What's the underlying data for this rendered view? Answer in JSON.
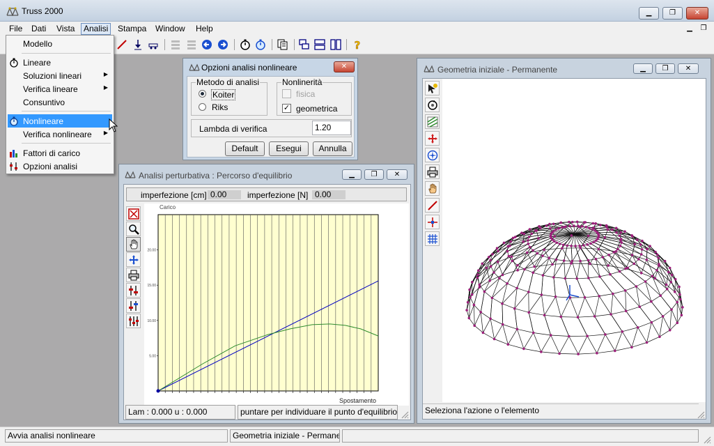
{
  "app": {
    "title": "Truss 2000"
  },
  "menubar": {
    "items": [
      "File",
      "Dati",
      "Vista",
      "Analisi",
      "Stampa",
      "Window",
      "Help"
    ]
  },
  "analisi_menu": {
    "items": [
      {
        "label": "Modello"
      },
      {
        "label": "Lineare"
      },
      {
        "label": "Soluzioni lineari"
      },
      {
        "label": "Verifica lineare"
      },
      {
        "label": "Consuntivo"
      },
      {
        "label": "Nonlineare"
      },
      {
        "label": "Verifica nonlineare"
      },
      {
        "label": "Fattori di carico"
      },
      {
        "label": "Opzioni analisi"
      }
    ]
  },
  "dialog": {
    "title": "Opzioni analisi nonlineare",
    "metodo_title": "Metodo di analisi",
    "metodo_options": [
      "Koiter",
      "Riks"
    ],
    "metodo_selected": "Koiter",
    "nonlin_title": "Nonlinerità",
    "nonlin_options": [
      {
        "label": "fisica",
        "checked": false,
        "enabled": false
      },
      {
        "label": "geometrica",
        "checked": true,
        "enabled": true
      }
    ],
    "lambda_label": "Lambda di verifica",
    "lambda_value": "1.20",
    "buttons": [
      "Default",
      "Esegui",
      "Annulla"
    ]
  },
  "perturb_window": {
    "title": "Analisi perturbativa : Percorso d'equilibrio",
    "imperf_cm_label": "imperfezione [cm]",
    "imperf_cm_value": "0.00",
    "imperf_n_label": "imperfezione [N]",
    "imperf_n_value": "0.00",
    "status_left": "Lam : 0.000  u : 0.000",
    "status_right": "puntare per individuare il punto d'equilibrio"
  },
  "geom_window": {
    "title": "Geometria iniziale - Permanente",
    "status": "Seleziona l'azione o l'elemento"
  },
  "statusbar": {
    "left": "Avvia analisi nonlineare",
    "middle": "Geometria iniziale - Permaner"
  },
  "colors": {
    "menu_highlight": "#3399ff",
    "plot_background": "#ffffd0",
    "linear_path": "#0000c0",
    "nonlinear_path": "#2e8b2e",
    "dome_members": "#000000",
    "dome_nodes": "#9b1f7a"
  },
  "chart_data": {
    "type": "line",
    "ylabel": "Carico",
    "xlabel": "Spostamento",
    "xlim": [
      0,
      1
    ],
    "ylim": [
      0,
      25
    ],
    "yticks": [
      "5.00",
      "10.00",
      "15.00",
      "20.00"
    ],
    "series": [
      {
        "color": "#0000c0",
        "x": [
          0,
          1
        ],
        "y": [
          0,
          15.6
        ]
      },
      {
        "color": "#2e8b2e",
        "x": [
          0,
          0.2,
          0.35,
          0.5,
          0.6,
          0.7,
          0.78,
          0.85,
          0.92,
          1.0
        ],
        "y": [
          0,
          3.8,
          6.4,
          8.0,
          8.8,
          9.4,
          9.5,
          9.3,
          8.8,
          7.8
        ]
      }
    ]
  }
}
